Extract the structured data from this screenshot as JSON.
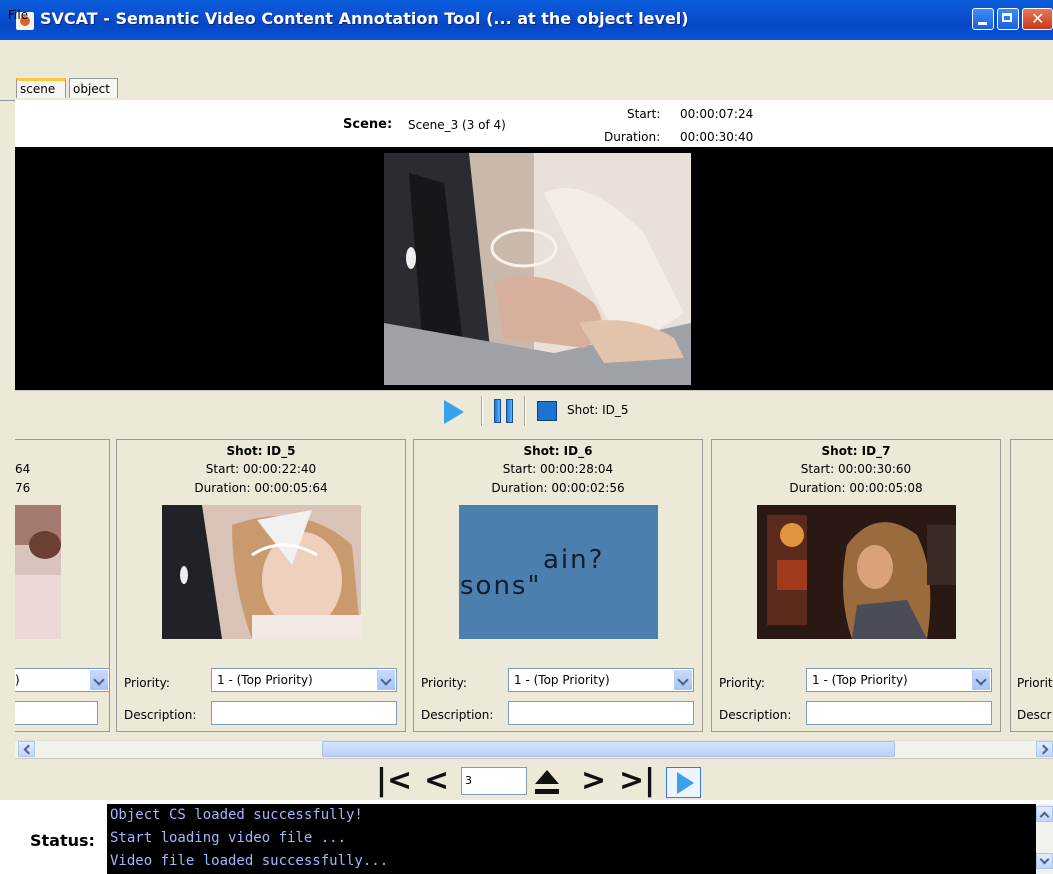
{
  "window": {
    "title": "SVCAT - Semantic Video Content Annotation Tool (... at the object level)"
  },
  "menu": {
    "file": "File"
  },
  "tabs": [
    "scene",
    "object"
  ],
  "scene": {
    "label": "Scene:",
    "value": "Scene_3 (3 of 4)",
    "start_label": "Start:",
    "start_value": "00:00:07:24",
    "duration_label": "Duration:",
    "duration_value": "00:00:30:40"
  },
  "player": {
    "current_shot": "Shot: ID_5"
  },
  "shots": [
    {
      "partial_start": "64",
      "partial_duration": "76",
      "partial_priority": ")"
    },
    {
      "title": "Shot: ID_5",
      "start": "Start: 00:00:22:40",
      "duration": "Duration: 00:00:05:64",
      "priority_label": "Priority:",
      "priority_value": "1 - (Top Priority)",
      "description_label": "Description:"
    },
    {
      "title": "Shot: ID_6",
      "start": "Start: 00:00:28:04",
      "duration": "Duration: 00:00:02:56",
      "priority_label": "Priority:",
      "priority_value": "1 - (Top Priority)",
      "description_label": "Description:",
      "thumb_text_1": "ain?",
      "thumb_text_2": "sons\""
    },
    {
      "title": "Shot: ID_7",
      "start": "Start: 00:00:30:60",
      "duration": "Duration: 00:00:05:08",
      "priority_label": "Priority:",
      "priority_value": "1 - (Top Priority)",
      "description_label": "Description:"
    },
    {
      "partial_priority_label": "Priorit",
      "partial_description_label": "Descr"
    }
  ],
  "navigation": {
    "page_value": "3"
  },
  "status": {
    "label": "Status:",
    "lines": [
      "Object CS loaded successfully!",
      "Start loading video file ...",
      "Video file loaded successfully..."
    ]
  },
  "colors": {
    "titlebar": "#0a54d6",
    "console_bg": "#000000",
    "console_text": "#9db8ff",
    "play_accent": "#3aa0f0"
  }
}
